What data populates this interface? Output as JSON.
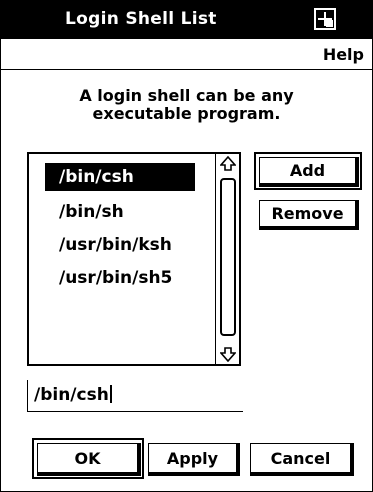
{
  "window": {
    "title": "Login Shell List"
  },
  "menubar": {
    "help_label": "Help"
  },
  "instruction": {
    "line1": "A login shell can be any",
    "line2": "executable program."
  },
  "shell_list": {
    "items": [
      {
        "label": "/bin/csh",
        "selected": true
      },
      {
        "label": "/bin/sh",
        "selected": false
      },
      {
        "label": "/usr/bin/ksh",
        "selected": false
      },
      {
        "label": "/usr/bin/sh5",
        "selected": false
      }
    ]
  },
  "side_buttons": {
    "add_label": "Add",
    "remove_label": "Remove"
  },
  "entry": {
    "value": "/bin/csh"
  },
  "dialog_buttons": {
    "ok_label": "OK",
    "apply_label": "Apply",
    "cancel_label": "Cancel"
  },
  "icons": {
    "window_menu": "window-menu-icon",
    "scroll_up": "arrow-up-icon",
    "scroll_down": "arrow-down-icon"
  }
}
